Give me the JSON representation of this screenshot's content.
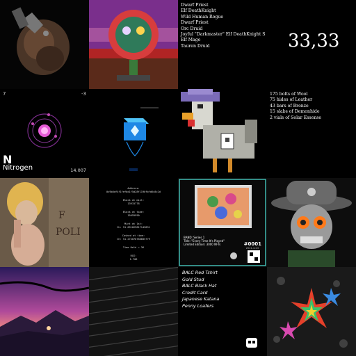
{
  "tiles": {
    "dwarf_list": [
      "Dwarf Priest",
      "Elf DeathKnight",
      "Wild Human Rogue",
      "Dwarf Priest",
      "Orc Druid",
      "Joyful \"Darkmaster\" Elf DeathKnight S",
      "Elf Mage",
      "Tauren Druid"
    ],
    "coords": "33,33",
    "element": {
      "number_left": "7",
      "number_right": "-3",
      "symbol": "N",
      "name": "Nitrogen",
      "mass": "14.007"
    },
    "materials": [
      "175 bolts of Wool",
      "75 hides of Leather",
      "43 bars of Bronze",
      "15 slabs of Demonhide",
      "2 vials of Solar Essense"
    ],
    "wallet": {
      "address_label": "Address:",
      "address": "0x9b6df4f1fefbd1f5d28f1190fbfd6c8c2d",
      "block_label": "Block at mint:",
      "block": "13915778",
      "block2_label": "Block at time:",
      "block2": "15055990",
      "mint_label": "Mint at 1st:",
      "mint": "Ch: 51.091029817145831",
      "cashed_label": "Cashed at time:",
      "cashed": "Ch: 51.274078768685779",
      "time_label": "Time Held = 36",
      "roi_label": "ROI:",
      "roi": "1.706"
    },
    "card": {
      "line1": "BAND: Series 1",
      "line2": "Title: \"Every Time It's Played\"",
      "line3": "Limited Edition: 3000 NFTs",
      "number": "#0001",
      "date": "2021.4.23"
    },
    "balc_list": [
      "BALC Red Tshirt",
      "Gold Stud",
      "BALC Black Hat",
      "Credit Card",
      "Japanese Katana",
      "Penny Loafers"
    ]
  }
}
